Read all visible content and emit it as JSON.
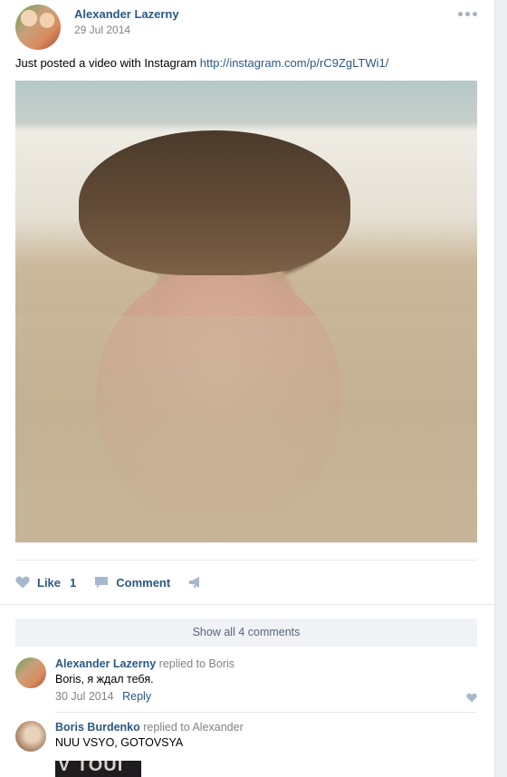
{
  "post": {
    "author": "Alexander Lazerny",
    "date": "29 Jul 2014",
    "text": "Just posted a video with Instagram",
    "link": "http://instagram.com/p/rC9ZgLTWi1/"
  },
  "actions": {
    "like_label": "Like",
    "like_count": "1",
    "comment_label": "Comment"
  },
  "comments": {
    "show_all_label": "Show all 4 comments",
    "items": [
      {
        "author": "Alexander Lazerny",
        "replied_to": "replied to Boris",
        "text": "Boris, я ждал тебя.",
        "date": "30 Jul 2014",
        "reply_label": "Reply"
      },
      {
        "author": "Boris Burdenko",
        "replied_to": "replied to Alexander",
        "text": "NUU VSYO, GOTOVSYA",
        "attachment_text": "V TOUI"
      }
    ]
  },
  "colors": {
    "link": "#2a5885",
    "secondary_text": "#828282",
    "icon": "#a8b8cc"
  }
}
